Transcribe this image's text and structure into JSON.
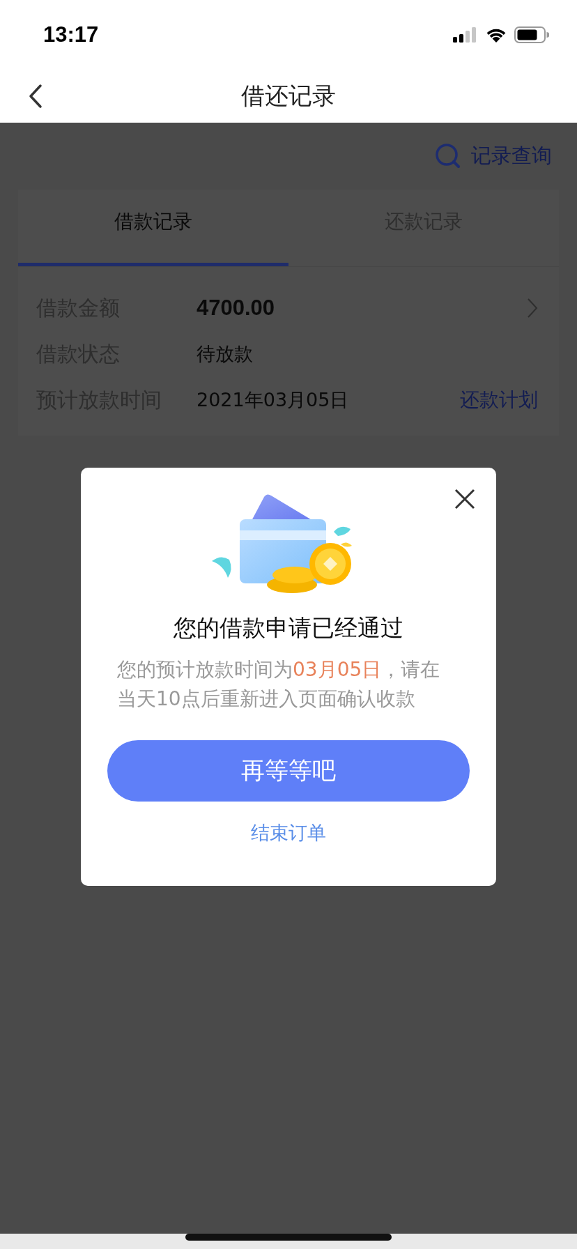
{
  "status_bar": {
    "time": "13:17"
  },
  "nav": {
    "title": "借还记录"
  },
  "search_link": {
    "label": "记录查询"
  },
  "tabs": [
    {
      "label": "借款记录",
      "selected": true
    },
    {
      "label": "还款记录",
      "selected": false
    }
  ],
  "record": {
    "rows": [
      {
        "label": "借款金额",
        "value": "4700.00",
        "kind": "amount"
      },
      {
        "label": "借款状态",
        "value": "待放款",
        "kind": "text"
      },
      {
        "label": "预计放款时间",
        "value": "2021年03月05日",
        "kind": "text",
        "link": "还款计划"
      }
    ]
  },
  "dialog": {
    "title": "您的借款申请已经通过",
    "message": [
      {
        "text": "您的预计放款时间为",
        "highlight": false
      },
      {
        "text": "03月05日",
        "highlight": true
      },
      {
        "text": "，请在当天10点后重新进入页面确认收款",
        "highlight": false
      }
    ],
    "primary_button": "再等等吧",
    "secondary_link": "结束订单"
  }
}
